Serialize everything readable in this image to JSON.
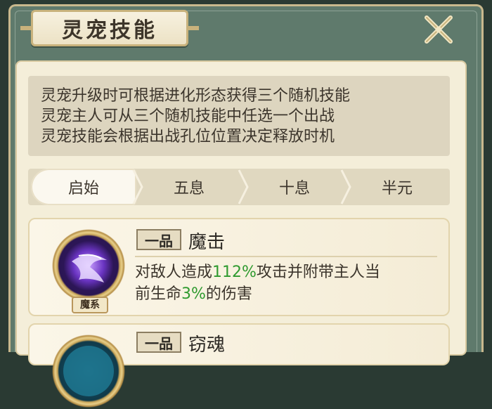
{
  "window": {
    "title": "灵宠技能"
  },
  "description": [
    "灵宠升级时可根据进化形态获得三个随机技能",
    "灵宠主人可从三个随机技能中任选一个出战",
    "灵宠技能会根据出战孔位位置决定释放时机"
  ],
  "tabs": [
    {
      "label": "启始",
      "active": true
    },
    {
      "label": "五息",
      "active": false
    },
    {
      "label": "十息",
      "active": false
    },
    {
      "label": "半元",
      "active": false
    }
  ],
  "skills": [
    {
      "grade": "一品",
      "name": "魔击",
      "type_tag": "魔系",
      "desc_line1_a": "对敌人造成",
      "desc_line1_hl": "112%",
      "desc_line1_b": "攻击并附带主人当",
      "desc_line2_a": "前生命",
      "desc_line2_hl": "3%",
      "desc_line2_b": "的伤害"
    },
    {
      "grade": "一品",
      "name": "窃魂"
    }
  ],
  "colors": {
    "frame": "#5f7a6c",
    "panel": "#f4eed9",
    "highlight": "#2f9a2f",
    "gold_border": "#c8b27c"
  },
  "icons": {
    "close": "close-x-icon",
    "skill_1": "demon-strike-icon",
    "skill_2": "soul-steal-icon"
  }
}
